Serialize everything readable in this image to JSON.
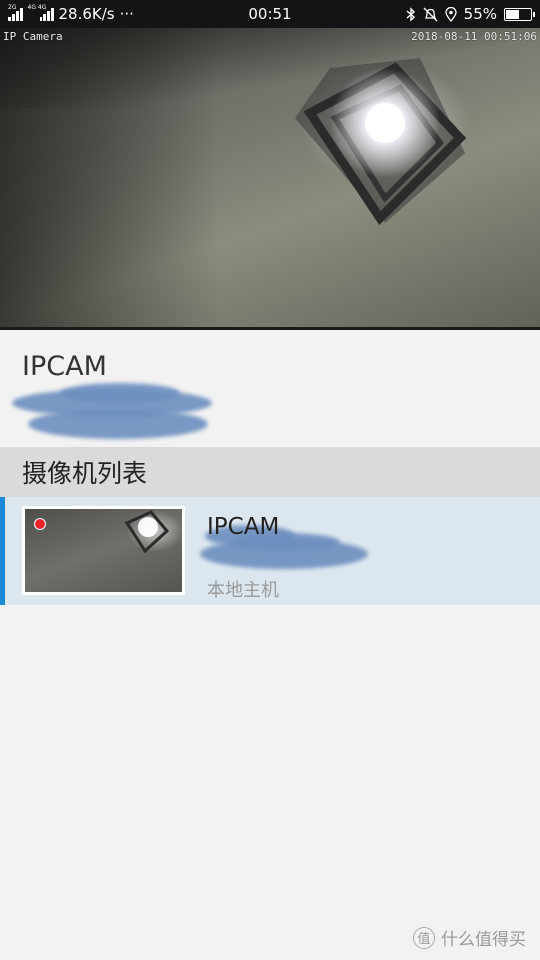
{
  "status_bar": {
    "network_2g": "2G",
    "network_4g": "4G 4G",
    "speed": "28.6K/s",
    "more": "···",
    "time": "00:51",
    "battery": "55%",
    "battery_level": 0.55,
    "icons": [
      "bluetooth-icon",
      "bell-off-icon",
      "location-icon",
      "battery-icon"
    ]
  },
  "feed": {
    "label": "IP Camera",
    "timestamp": "2018-08-11 00:51:06"
  },
  "device": {
    "name": "IPCAM"
  },
  "camera_list": {
    "header": "摄像机列表",
    "items": [
      {
        "name": "IPCAM",
        "host": "本地主机",
        "recording": true
      }
    ]
  },
  "watermark": {
    "badge": "值",
    "text": "什么值得买"
  },
  "colors": {
    "accent": "#1a88d6",
    "selected_row": "#dce6ee",
    "section_header": "#dadada",
    "record": "#e8222a",
    "redaction": "#6d8fbf"
  }
}
